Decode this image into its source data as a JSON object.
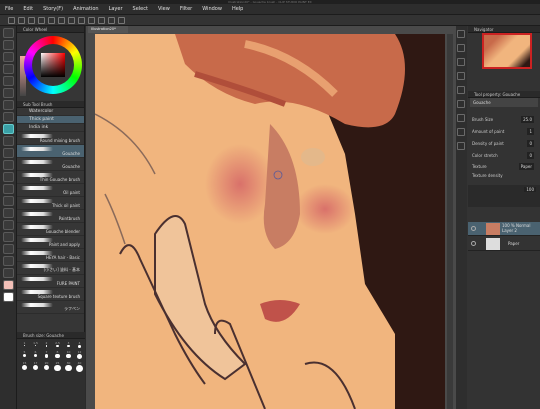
{
  "app": {
    "title": "Illustration20* - Gouache brush - CLIP STUDIO PAINT EX"
  },
  "menu": [
    "File",
    "Edit",
    "Story(F)",
    "Animation",
    "Layer",
    "Select",
    "View",
    "Filter",
    "Window",
    "Help"
  ],
  "document": {
    "tab_label": "Illustration20*"
  },
  "color_wheel": {
    "title": "Color Wheel",
    "hue_color": "#ff0000"
  },
  "subtool": {
    "title": "Sub Tool Brush",
    "rows": [
      "Watercolor",
      "Thick paint",
      "India ink"
    ],
    "selected": 1
  },
  "brushes": [
    "Round mixing brush",
    "Gouache",
    "Gouache",
    "Thin Gouache brush",
    "Oil paint",
    "Thick oil paint",
    "Paintbrush",
    "Gouache blender",
    "Paint and apply",
    "HEYA hair - Basic",
    "[小さい] 塗料 - 基本",
    "FURE PAINT",
    "Square texture brush",
    "ラフペン"
  ],
  "selected_brush": 1,
  "brush_size_panel": {
    "title": "Brush size: Gouache",
    "sizes": [
      "1",
      "1.5",
      "2",
      "2.5",
      "3",
      "4",
      "5",
      "6",
      "7",
      "8",
      "10",
      "12",
      "15",
      "17",
      "20",
      "25",
      "30",
      "40"
    ]
  },
  "navigator": {
    "title": "Navigator"
  },
  "tool_property": {
    "title": "Tool property: Gouache",
    "tool_name": "Gouache",
    "rows": [
      {
        "label": "Brush Size",
        "value": "25.0"
      },
      {
        "label": "Amount of paint",
        "value": "1"
      },
      {
        "label": "Density of paint",
        "value": "0"
      },
      {
        "label": "Color stretch",
        "value": "0"
      },
      {
        "label": "Texture",
        "value": "Paper"
      },
      {
        "label": "Texture density",
        "value": ""
      }
    ]
  },
  "layers": [
    {
      "name": "100 % Normal\nLayer 2",
      "opacity": "100",
      "selected": true
    },
    {
      "name": "Paper",
      "opacity": "",
      "selected": false
    }
  ],
  "layer_opacity": "100"
}
